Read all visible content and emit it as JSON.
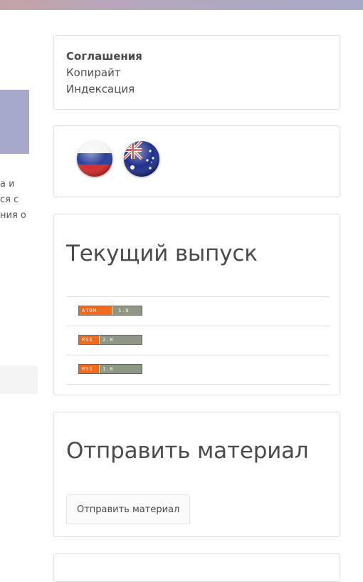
{
  "left": {
    "text_lines": [
      "а и",
      "ся с",
      "ния о"
    ]
  },
  "agreements": {
    "title": "Соглашения",
    "links": [
      "Копирайт",
      "Индексация"
    ]
  },
  "languages": {
    "flags": [
      "russia-flag-icon",
      "australia-flag-icon"
    ]
  },
  "current_issue": {
    "title": "Текущий выпуск",
    "feeds": [
      {
        "key": "ATOM",
        "version": "1.0"
      },
      {
        "key": "RSS",
        "version": "2.0"
      },
      {
        "key": "RSS",
        "version": "1.0"
      }
    ]
  },
  "submit": {
    "title": "Отправить материал",
    "button_label": "Отправить материал"
  },
  "colors": {
    "header_gradient_start": "#c4a3a6",
    "header_gradient_end": "#a7aac7",
    "feed_badge_orange": "#f26a1b",
    "feed_badge_gray": "#8e9684"
  }
}
